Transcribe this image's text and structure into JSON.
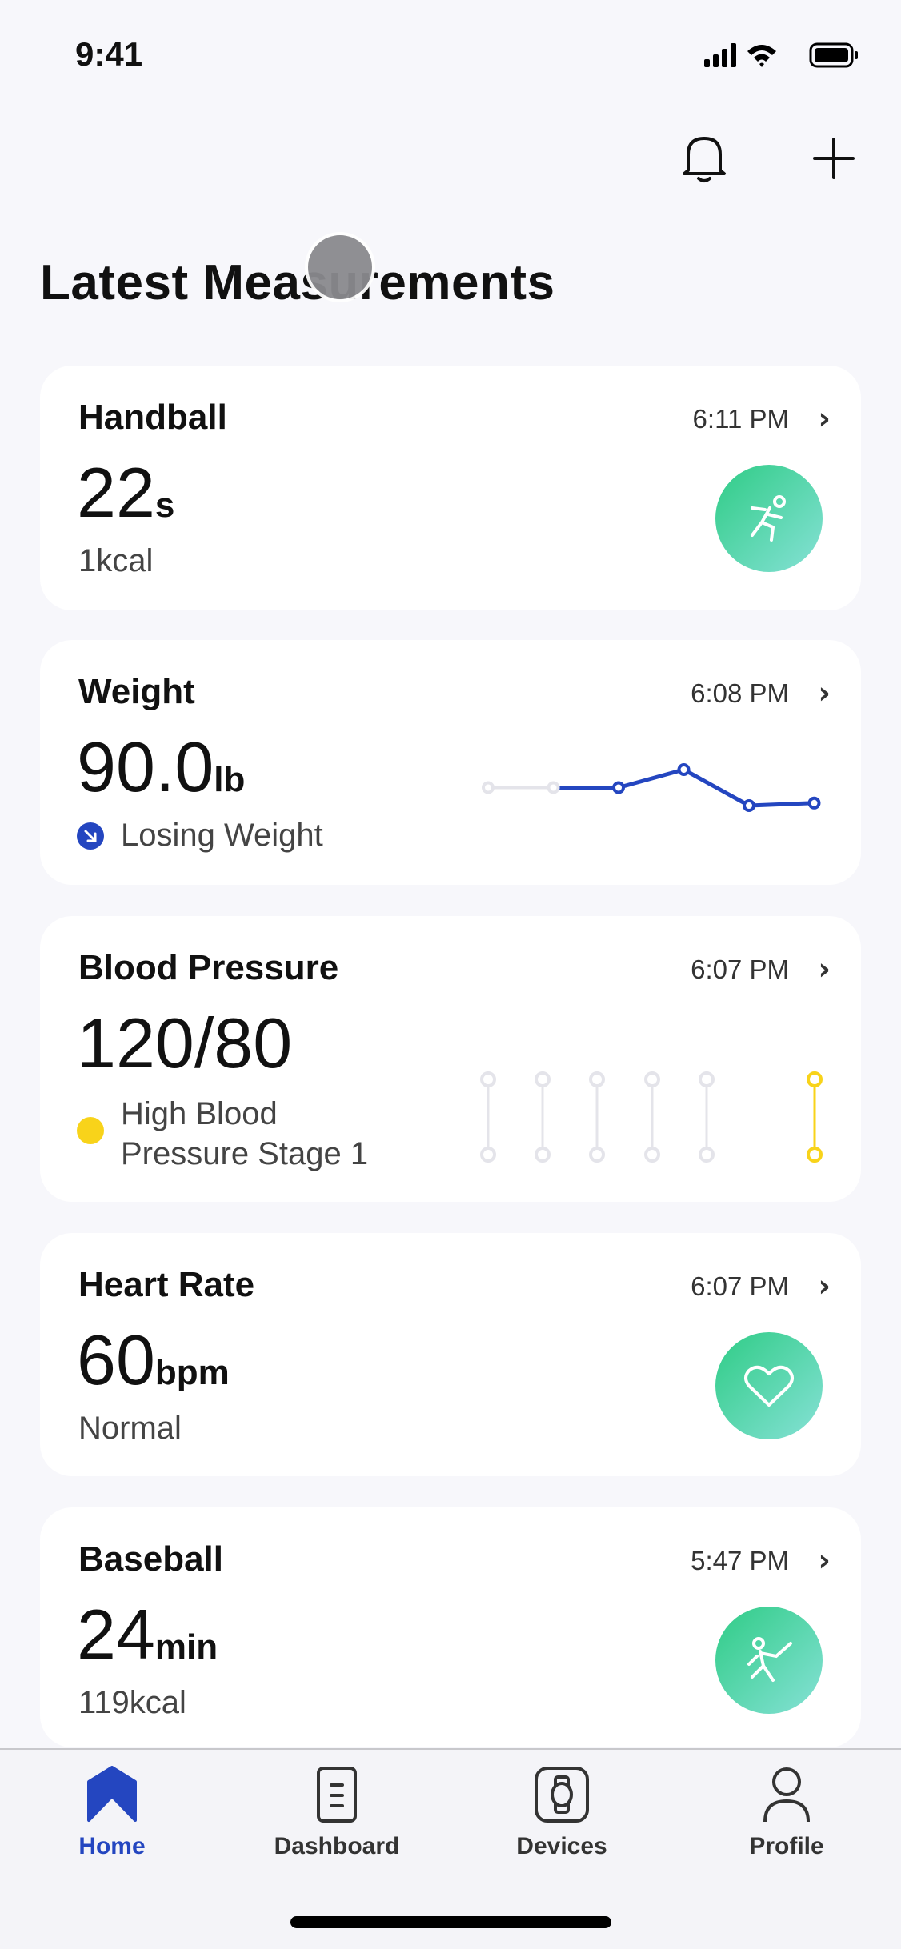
{
  "status_bar": {
    "time": "9:41"
  },
  "header": {
    "title": "Latest Measurements",
    "icons": [
      "bell-icon",
      "plus-icon"
    ]
  },
  "colors": {
    "accent": "#2446c0",
    "warning": "#f8d31a",
    "inactive": "#e4e4ea",
    "badge_gradient": [
      "#2fcc86",
      "#86e1d6"
    ]
  },
  "cards": [
    {
      "title": "Handball",
      "time": "6:11 PM",
      "value": "22",
      "unit": "s",
      "sub": "1kcal",
      "icon": "handball-icon"
    },
    {
      "title": "Weight",
      "time": "6:08 PM",
      "value": "90.0",
      "unit": "lb",
      "sub": "Losing Weight",
      "icon": "trend-down-icon",
      "trend": [
        null,
        null,
        90.5,
        91.2,
        89.8,
        89.9
      ]
    },
    {
      "title": "Blood Pressure",
      "time": "6:07 PM",
      "value": "120/80",
      "unit": "",
      "sub_line1": "High Blood",
      "sub_line2": "Pressure Stage 1",
      "readings": [
        {
          "active": false
        },
        {
          "active": false
        },
        {
          "active": false
        },
        {
          "active": false
        },
        {
          "active": false
        },
        {
          "active": true
        }
      ]
    },
    {
      "title": "Heart Rate",
      "time": "6:07 PM",
      "value": "60",
      "unit": "bpm",
      "sub": "Normal",
      "icon": "heart-icon"
    },
    {
      "title": "Baseball",
      "time": "5:47 PM",
      "value": "24",
      "unit": "min",
      "sub": "119kcal",
      "icon": "baseball-icon"
    }
  ],
  "tabs": [
    {
      "label": "Home",
      "active": true
    },
    {
      "label": "Dashboard",
      "active": false
    },
    {
      "label": "Devices",
      "active": false
    },
    {
      "label": "Profile",
      "active": false
    }
  ]
}
